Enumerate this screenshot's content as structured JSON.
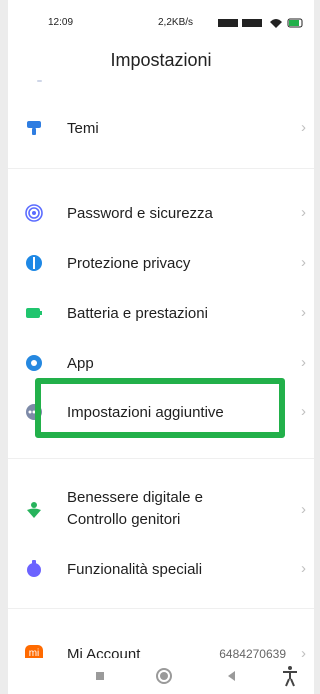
{
  "status_bar": {
    "time": "12:09",
    "right": "2,2KB/s"
  },
  "header": {
    "title": "Impostazioni"
  },
  "items": [
    {
      "label": "Temi",
      "color": "#2f7de1"
    },
    {
      "label": "Password e sicurezza",
      "color": "#5b6cff"
    },
    {
      "label": "Protezione privacy",
      "color": "#1e88e5"
    },
    {
      "label": "Batteria e prestazioni",
      "color": "#20c56e"
    },
    {
      "label": "App",
      "color": "#2588e0"
    },
    {
      "label": "Impostazioni aggiuntive",
      "color": "#7d8aa8"
    },
    {
      "label_line1": "Benessere digitale e",
      "label_line2": "Controllo genitori",
      "color": "#27b35c"
    },
    {
      "label": "Funzionalità speciali",
      "color": "#6c63ff"
    },
    {
      "label": "Mi Account",
      "value": "6484270639",
      "color": "#ff6a00",
      "badge": "mi"
    }
  ],
  "highlight": {
    "color": "#22b04a"
  },
  "nav": {
    "icons": [
      "square-icon",
      "home-circle-icon",
      "back-icon",
      "accessibility-icon"
    ]
  }
}
